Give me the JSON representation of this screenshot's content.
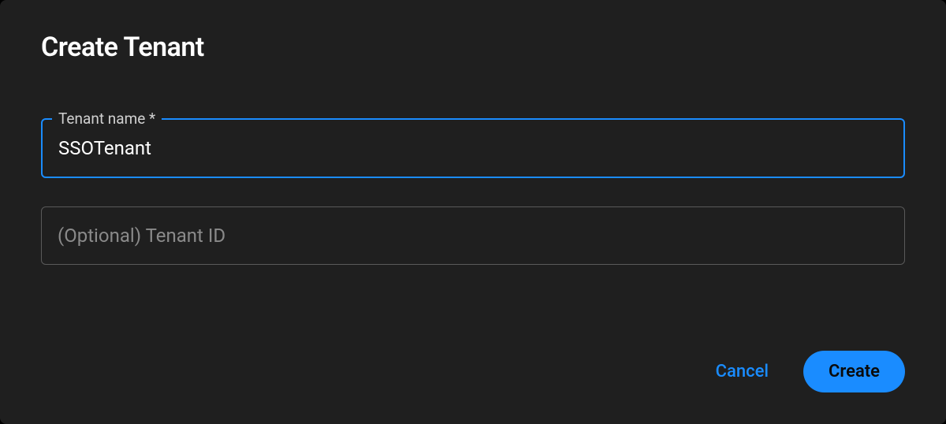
{
  "dialog": {
    "title": "Create Tenant",
    "fields": {
      "tenant_name": {
        "label": "Tenant name *",
        "value": "SSOTenant"
      },
      "tenant_id": {
        "placeholder": "(Optional) Tenant ID",
        "value": ""
      }
    },
    "actions": {
      "cancel_label": "Cancel",
      "create_label": "Create"
    }
  }
}
